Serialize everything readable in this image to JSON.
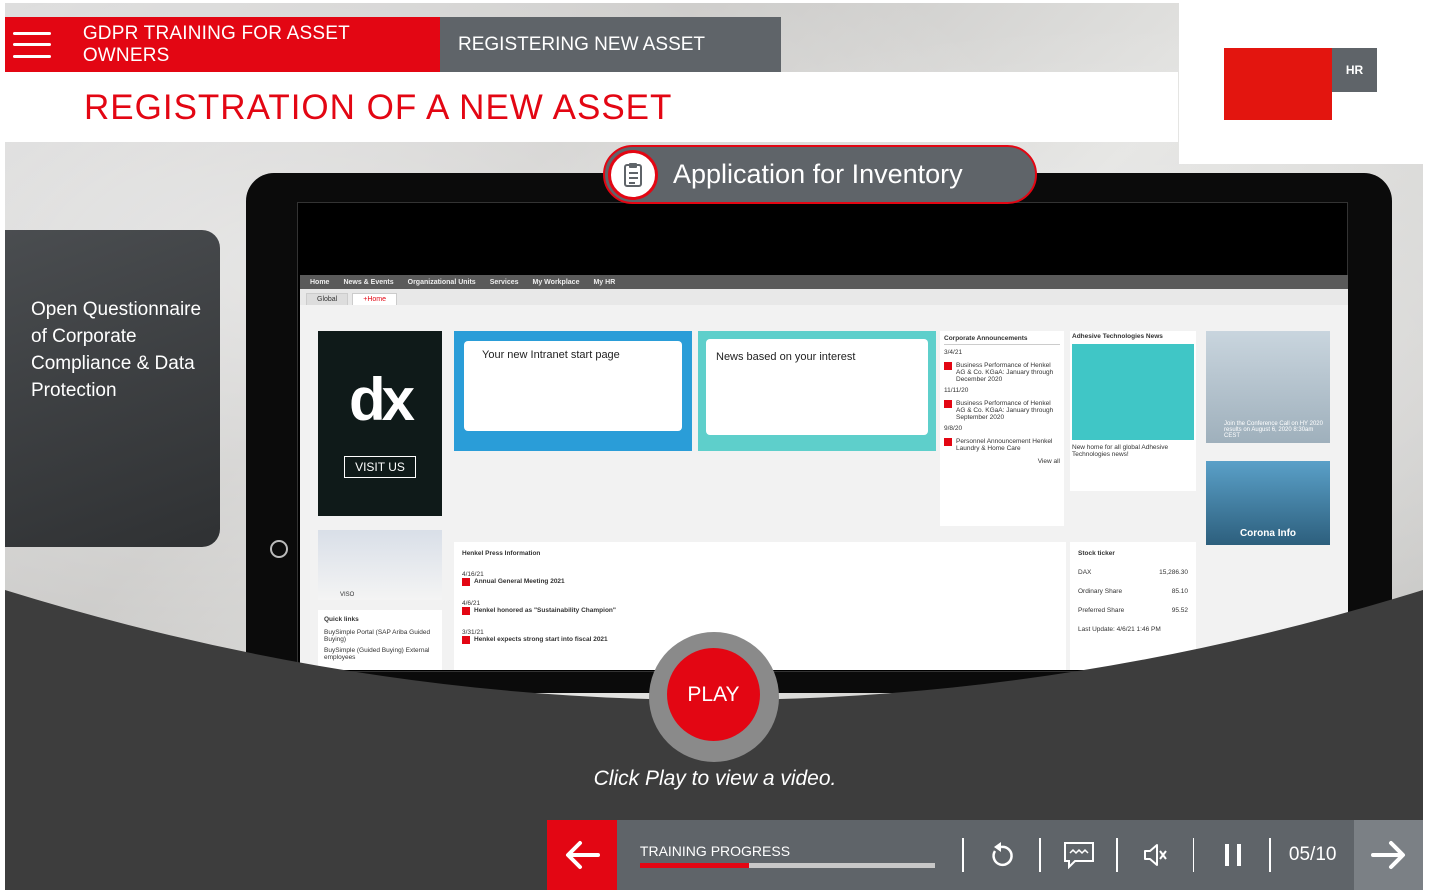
{
  "header": {
    "course_title": "GDPR TRAINING FOR ASSET OWNERS",
    "chapter_title": "REGISTERING NEW ASSET",
    "page_title": "REGISTRATION OF A NEW ASSET"
  },
  "logo": {
    "badge": "HR"
  },
  "app_pill": {
    "label": "Application for Inventory"
  },
  "side_card": {
    "label": "Open Questionnaire of Corporate Compliance & Data Protection"
  },
  "intranet": {
    "nav": [
      "Home",
      "News & Events",
      "Organizational Units",
      "Services",
      "My Workplace",
      "My HR"
    ],
    "tabs": [
      "Global",
      "+Home"
    ],
    "dx": {
      "logo": "dx",
      "button": "VISIT US"
    },
    "banner1": {
      "title": "Your new Intranet start page"
    },
    "banner2": {
      "title": "News based on your interest"
    },
    "corporate": {
      "heading": "Corporate Announcements",
      "items": [
        {
          "date": "3/4/21",
          "text": "Business Performance of Henkel AG & Co. KGaA: January through December 2020"
        },
        {
          "date": "11/11/20",
          "text": "Business Performance of Henkel AG & Co. KGaA: January through September 2020"
        },
        {
          "date": "9/8/20",
          "text": "Personnel Announcement Henkel Laundry & Home Care"
        }
      ],
      "view_all": "View all"
    },
    "adhesive": {
      "heading": "Adhesive Technologies News",
      "text": "New home for all global Adhesive Technologies news!"
    },
    "conference": "Join the Conference Call on HY 2020 results on August 6, 2020 8:30am CEST",
    "corona": "Corona Info",
    "people_label": "VISO",
    "quick_links": {
      "heading": "Quick links",
      "items": [
        "BuySimple Portal (SAP Ariba Guided Buying)",
        "BuySimple (Guided Buying) External employees"
      ]
    },
    "press": {
      "heading": "Henkel Press Information",
      "items": [
        {
          "date": "4/16/21",
          "title": "Annual General Meeting 2021"
        },
        {
          "date": "4/6/21",
          "title": "Henkel honored as \"Sustainability Champion\""
        },
        {
          "date": "3/31/21",
          "title": "Henkel expects strong start into fiscal 2021"
        }
      ]
    },
    "stock": {
      "heading": "Stock ticker",
      "rows": [
        {
          "name": "DAX",
          "value": "15,286.30"
        },
        {
          "name": "Ordinary Share",
          "value": "85.10"
        },
        {
          "name": "Preferred Share",
          "value": "95.52"
        }
      ],
      "updated": "Last Update: 4/6/21 1:46 PM"
    }
  },
  "player": {
    "play_label": "PLAY",
    "hint": "Click Play to view a video.",
    "progress_label": "TRAINING PROGRESS",
    "progress": 0.37,
    "counter": "05/10"
  },
  "colors": {
    "accent": "#e30613",
    "bar": "#5f6469"
  }
}
